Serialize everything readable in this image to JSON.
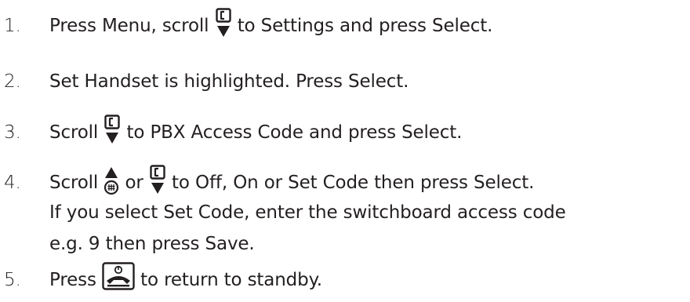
{
  "steps": [
    {
      "number": "1.",
      "parts": {
        "a": "Press ",
        "b": "Menu",
        "c": ", scroll ",
        "d": " to ",
        "e": "Settings",
        "f": " and press ",
        "g": "Select",
        "h": "."
      },
      "icons": [
        "scroll-down-phonebook-key"
      ]
    },
    {
      "number": "2.",
      "parts": {
        "a": "Set Handset",
        "b": " is highlighted. Press ",
        "c": "Select",
        "d": "."
      }
    },
    {
      "number": "3.",
      "parts": {
        "a": "Scroll ",
        "b": " to ",
        "c": "PBX Access Code",
        "d": " and press ",
        "e": "Select",
        "f": "."
      },
      "icons": [
        "scroll-down-phonebook-key"
      ]
    },
    {
      "number": "4.",
      "parts": {
        "a": "Scroll ",
        "b": " or ",
        "c": " to ",
        "d": "Off",
        "e": ", ",
        "f": "On",
        "g": " or ",
        "h": "Set Code",
        "i": " then press ",
        "j": "Select",
        "k": "."
      },
      "continuation": {
        "line1": {
          "a": "If you select ",
          "b": "Set Code",
          "c": ", enter the switchboard access code"
        },
        "line2": {
          "a": "e.g. 9 then press ",
          "b": "Save",
          "c": "."
        }
      },
      "icons": [
        "scroll-up-calls-key",
        "scroll-down-phonebook-key"
      ]
    },
    {
      "number": "5.",
      "parts": {
        "a": "Press ",
        "b": " to return to standby."
      },
      "icons": [
        "end-call-key"
      ]
    }
  ]
}
